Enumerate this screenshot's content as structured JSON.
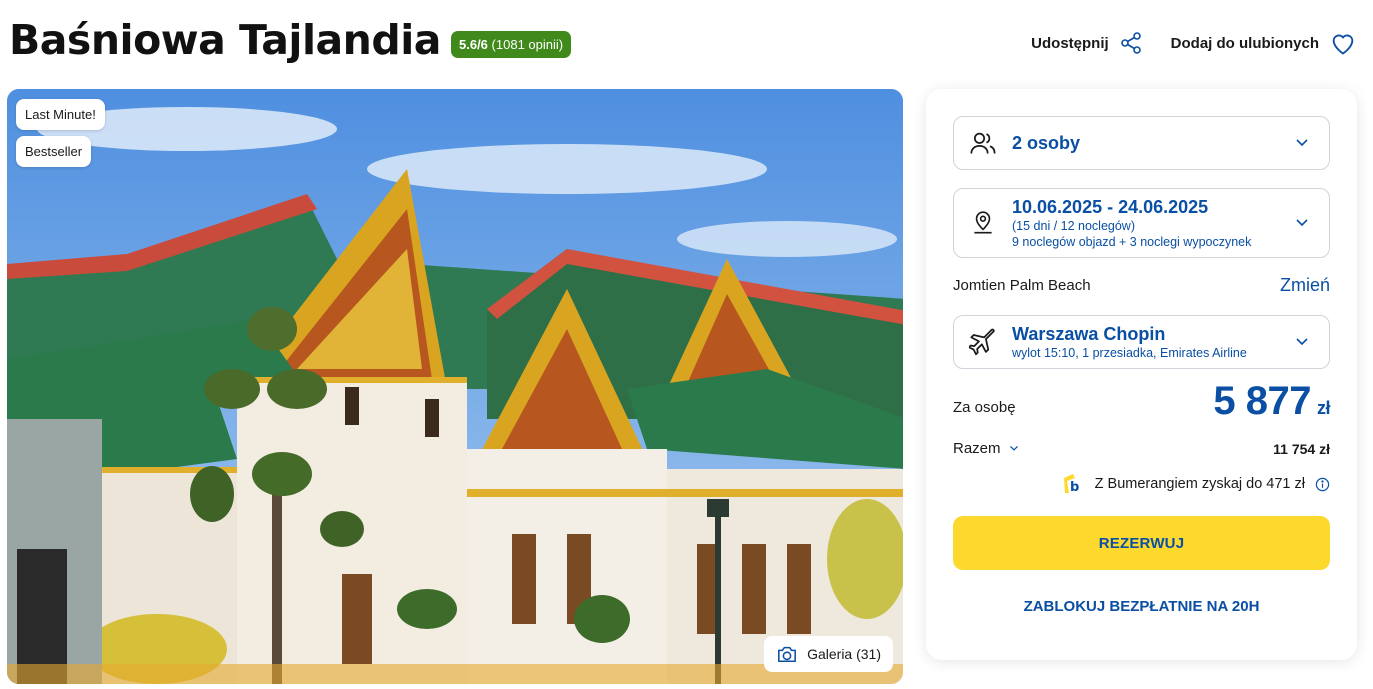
{
  "header": {
    "title": "Baśniowa Tajlandia",
    "rating_score": "5.6/6",
    "rating_count": "(1081 opinii)",
    "share_label": "Udostępnij",
    "favorite_label": "Dodaj do ulubionych"
  },
  "hero": {
    "tags": [
      "Last Minute!",
      "Bestseller"
    ],
    "gallery_label": "Galeria (31)"
  },
  "booking": {
    "persons": "2 osoby",
    "dates": "10.06.2025 - 24.06.2025",
    "duration": "(15 dni / 12 noclegów)",
    "nights_detail": "9 noclegów objazd + 3 noclegi wypoczynek",
    "hotel": "Jomtien Palm Beach",
    "change_label": "Zmień",
    "airport": "Warszawa Chopin",
    "flight_detail": "wylot 15:10, 1 przesiadka, Emirates Airline",
    "per_person_label": "Za osobę",
    "price": "5 877",
    "currency": "zł",
    "total_label": "Razem",
    "total_value": "11 754 zł",
    "bumerang_text": "Z Bumerangiem zyskaj do 471 zł",
    "reserve_label": "REZERWUJ",
    "block_label": "ZABLOKUJ BEZPŁATNIE NA 20H"
  },
  "colors": {
    "brand_blue": "#0a4fa3",
    "accent_yellow": "#fdd92e",
    "rating_green": "#3f8a1a"
  },
  "icons": [
    "share-icon",
    "heart-icon",
    "camera-icon",
    "users-icon",
    "map-pin-icon",
    "plane-icon",
    "chevron-down-icon",
    "bumerang-logo-icon",
    "info-icon"
  ]
}
